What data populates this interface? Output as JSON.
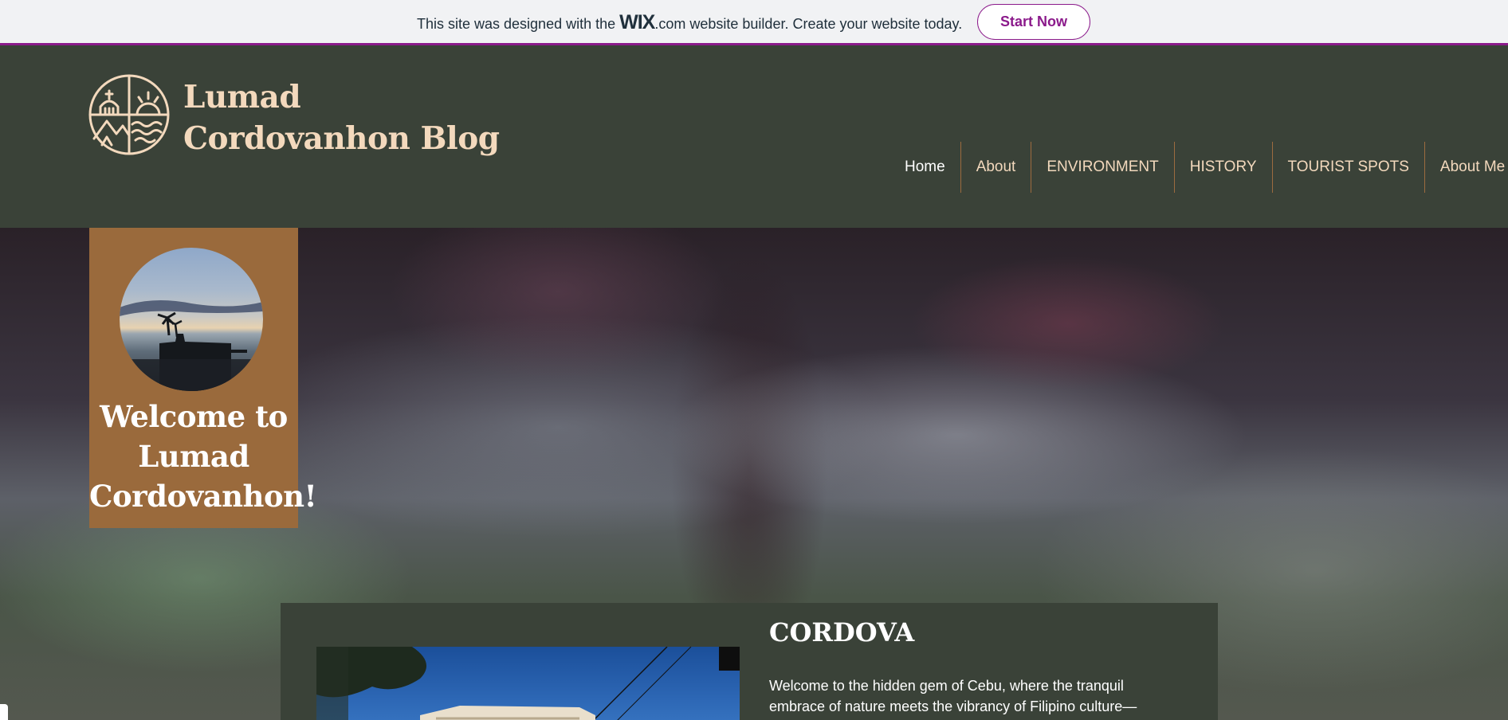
{
  "wix_banner": {
    "text_before": "This site was designed with the",
    "logo": "WIX",
    "logo_suffix": ".com",
    "text_after": "website builder. Create your website today.",
    "cta": "Start Now"
  },
  "header": {
    "title_line1": "Lumad",
    "title_line2": "Cordovanhon Blog",
    "logo_icon": "emblem-icon"
  },
  "nav": {
    "items": [
      {
        "label": "Home",
        "active": true
      },
      {
        "label": "About"
      },
      {
        "label": "ENVIRONMENT"
      },
      {
        "label": "HISTORY"
      },
      {
        "label": "TOURIST SPOTS"
      },
      {
        "label": "About Me"
      }
    ]
  },
  "hero": {
    "welcome_line1": "Welcome to",
    "welcome_line2": "Lumad",
    "welcome_line3": "Cordovanhon!"
  },
  "section": {
    "title": "CORDOVA",
    "body_line1": "Welcome to the hidden gem of Cebu, where the tranquil",
    "body_line2": "embrace of nature meets the vibrancy of Filipino culture—"
  },
  "colors": {
    "banner_accent": "#8b1a8b",
    "header_bg": "#3a4238",
    "title_color": "#f3d9bd",
    "card_bg": "#9a6a3c",
    "nav_divider": "#9c6b3f"
  }
}
